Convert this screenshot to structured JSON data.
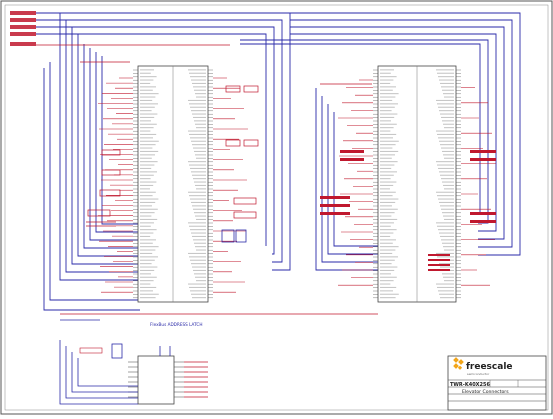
{
  "title_block": {
    "company": "freescale",
    "company_sub": "semiconductor",
    "board": "TWR-K40X256",
    "sheet_title": "Elevator Connectors"
  },
  "chips": {
    "flexbus_label": "FlexBus ADDRESS LATCH"
  },
  "colors": {
    "net_blue": "#2a2aa8",
    "net_red": "#c0182e",
    "frame": "#555555"
  }
}
